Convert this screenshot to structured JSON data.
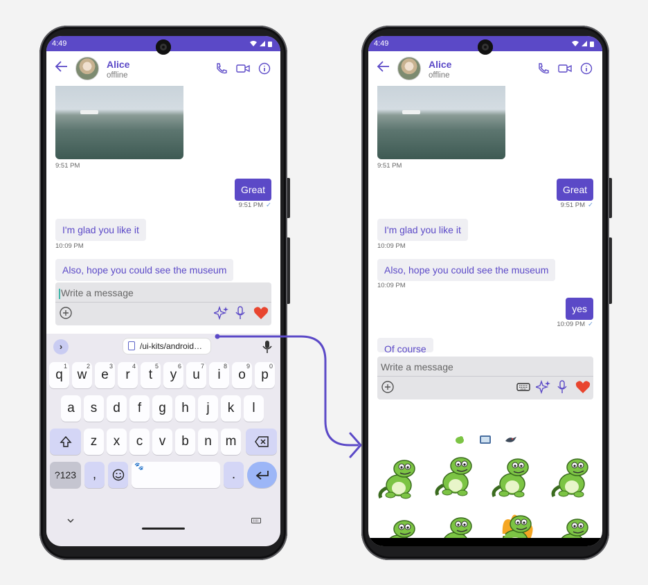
{
  "status": {
    "time": "4:49"
  },
  "contact": {
    "name": "Alice",
    "presence": "offline"
  },
  "messages": {
    "photo_time": "9:51 PM",
    "great": {
      "text": "Great",
      "time": "9:51 PM"
    },
    "glad": {
      "text": "I'm glad you like it",
      "time": "10:09 PM"
    },
    "museum": {
      "text": "Also, hope you could see the museum",
      "time": "10:09 PM"
    },
    "yes": {
      "text": "yes",
      "time": "10:09 PM"
    },
    "of_course": {
      "text": "Of course"
    }
  },
  "composer": {
    "placeholder": "Write a message"
  },
  "keyboard": {
    "clipboard_text": "/ui-kits/android…",
    "row1": [
      {
        "key": "q",
        "hint": "1"
      },
      {
        "key": "w",
        "hint": "2"
      },
      {
        "key": "e",
        "hint": "3"
      },
      {
        "key": "r",
        "hint": "4"
      },
      {
        "key": "t",
        "hint": "5"
      },
      {
        "key": "y",
        "hint": "6"
      },
      {
        "key": "u",
        "hint": "7"
      },
      {
        "key": "i",
        "hint": "8"
      },
      {
        "key": "o",
        "hint": "9"
      },
      {
        "key": "p",
        "hint": "0"
      }
    ],
    "row2": [
      "a",
      "s",
      "d",
      "f",
      "g",
      "h",
      "j",
      "k",
      "l"
    ],
    "row3": [
      "z",
      "x",
      "c",
      "v",
      "b",
      "n",
      "m"
    ],
    "symbols_label": "?123",
    "comma_label": ",",
    "period_label": "."
  },
  "colors": {
    "brand": "#5b49c7",
    "keyboard_bg": "#ebe9f0",
    "heart": "#e8452f",
    "sticker_green": "#7cc444"
  },
  "icons": [
    "back-arrow-icon",
    "phone-icon",
    "video-icon",
    "info-icon",
    "add-circle-icon",
    "sticker-icon",
    "sparkle-icon",
    "mic-icon",
    "heart-icon",
    "keyboard-icon",
    "enter-icon",
    "backspace-icon",
    "shift-icon",
    "emoji-icon"
  ]
}
